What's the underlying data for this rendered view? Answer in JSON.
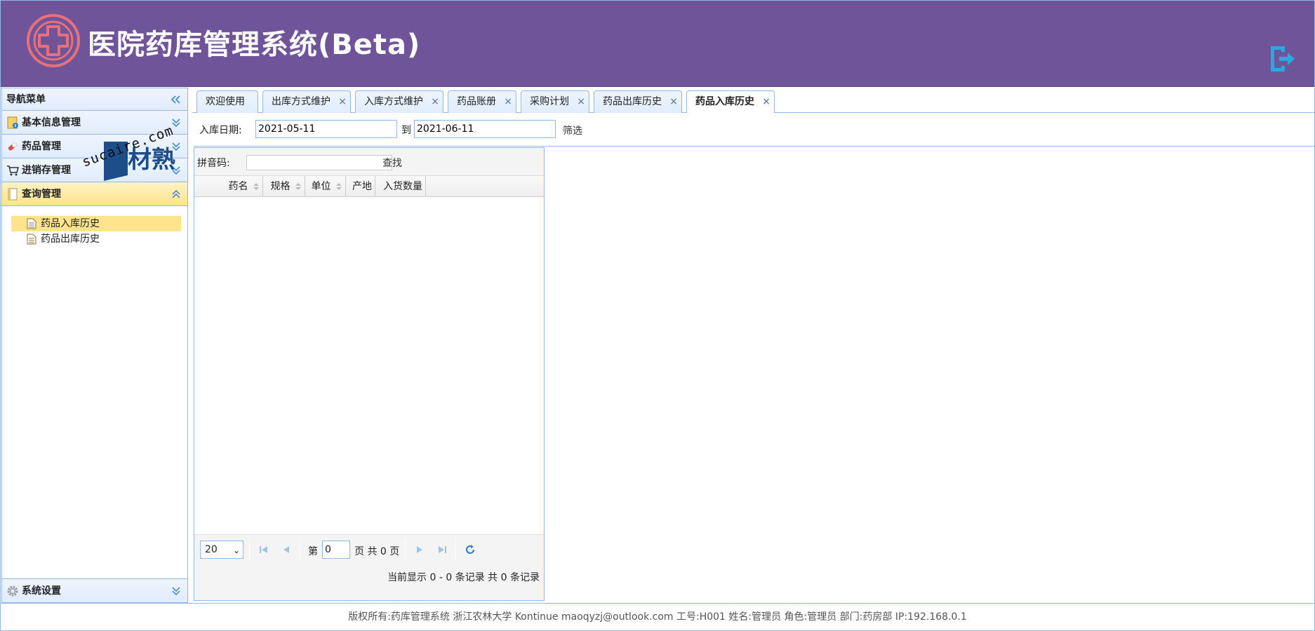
{
  "app": {
    "title": "医院药库管理系统(Beta)",
    "brand_color": "#6f5499",
    "logo_icon": "hospital-cross-icon",
    "logout_icon": "logout-icon"
  },
  "sidebar": {
    "title": "导航菜单",
    "sections": [
      {
        "label": "基本信息管理",
        "icon": "info-folder-icon"
      },
      {
        "label": "药品管理",
        "icon": "pill-icon"
      },
      {
        "label": "进销存管理",
        "icon": "cart-icon"
      },
      {
        "label": "查询管理",
        "icon": "document-icon"
      }
    ],
    "query_items": [
      {
        "label": "药品入库历史",
        "selected": true
      },
      {
        "label": "药品出库历史",
        "selected": false
      }
    ],
    "bottom_section": {
      "label": "系统设置",
      "icon": "gear-icon"
    }
  },
  "watermark": {
    "text1": "素材熟",
    "text2": "sucaire.com"
  },
  "tabs": [
    {
      "label": "欢迎使用",
      "closable": false
    },
    {
      "label": "出库方式维护",
      "closable": true
    },
    {
      "label": "入库方式维护",
      "closable": true
    },
    {
      "label": "药品账册",
      "closable": true
    },
    {
      "label": "采购计划",
      "closable": true
    },
    {
      "label": "药品出库历史",
      "closable": true
    },
    {
      "label": "药品入库历史",
      "closable": true,
      "active": true
    }
  ],
  "filter": {
    "date_label": "入库日期:",
    "start_date": "2021-05-11",
    "to_label": "到",
    "end_date": "2021-06-11",
    "filter_button": "筛选"
  },
  "grid": {
    "search_label": "拼音码:",
    "search_value": "",
    "search_button": "查找",
    "columns": [
      "药名",
      "规格",
      "单位",
      "产地",
      "入货数量"
    ],
    "rows": []
  },
  "pager": {
    "page_size": "20",
    "page_prefix": "第",
    "page_number": "0",
    "page_suffix": "页 共 0 页",
    "summary": "当前显示 0 - 0 条记录 共 0 条记录"
  },
  "footer": {
    "text": "版权所有:药库管理系统 浙江农林大学 Kontinue maoqyzj@outlook.com 工号:H001 姓名:管理员 角色:管理员 部门:药房部 IP:192.168.0.1"
  }
}
